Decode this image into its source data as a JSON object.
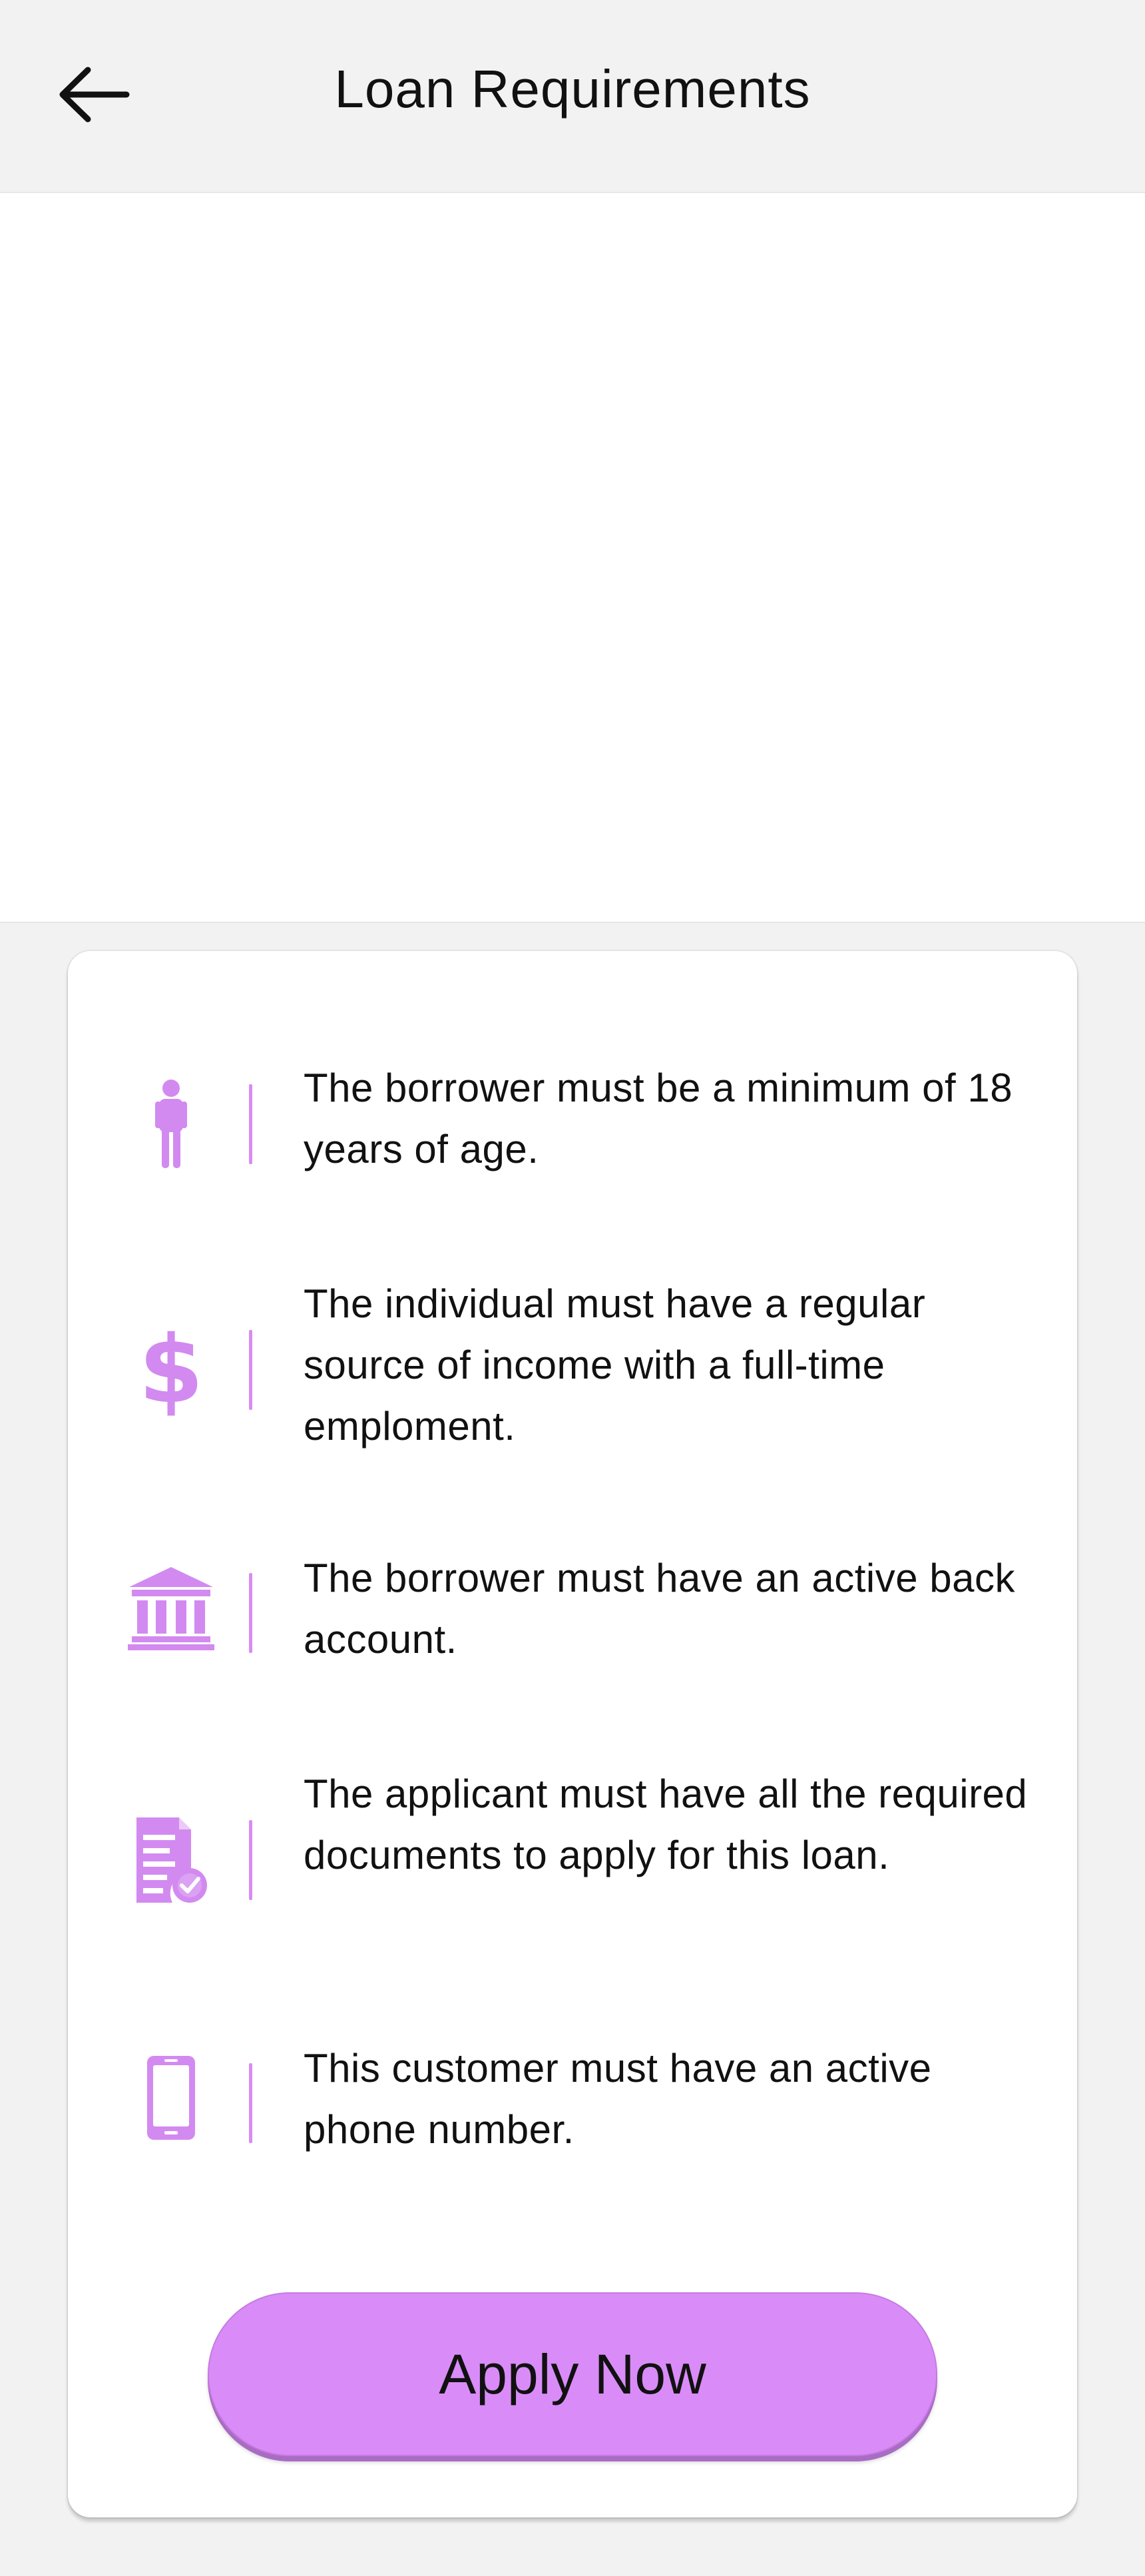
{
  "header": {
    "title": "Loan Requirements",
    "back_icon": "arrow-left-icon"
  },
  "requirements": {
    "items": [
      {
        "icon": "person-icon",
        "text": "The borrower must be a minimum of 18 years of age."
      },
      {
        "icon": "dollar-icon",
        "text": "The individual must have a regular source of income with a full-time emploment."
      },
      {
        "icon": "bank-icon",
        "text": "The borrower must have an active back account."
      },
      {
        "icon": "document-check-icon",
        "text": "The applicant must have all the required documents to apply for this loan."
      },
      {
        "icon": "phone-icon",
        "text": "This customer must have an active phone number."
      }
    ]
  },
  "actions": {
    "apply_label": "Apply Now"
  },
  "colors": {
    "accent": "#d98cf7",
    "icon": "#d28af0",
    "background": "#f2f2f2",
    "card": "#ffffff"
  }
}
